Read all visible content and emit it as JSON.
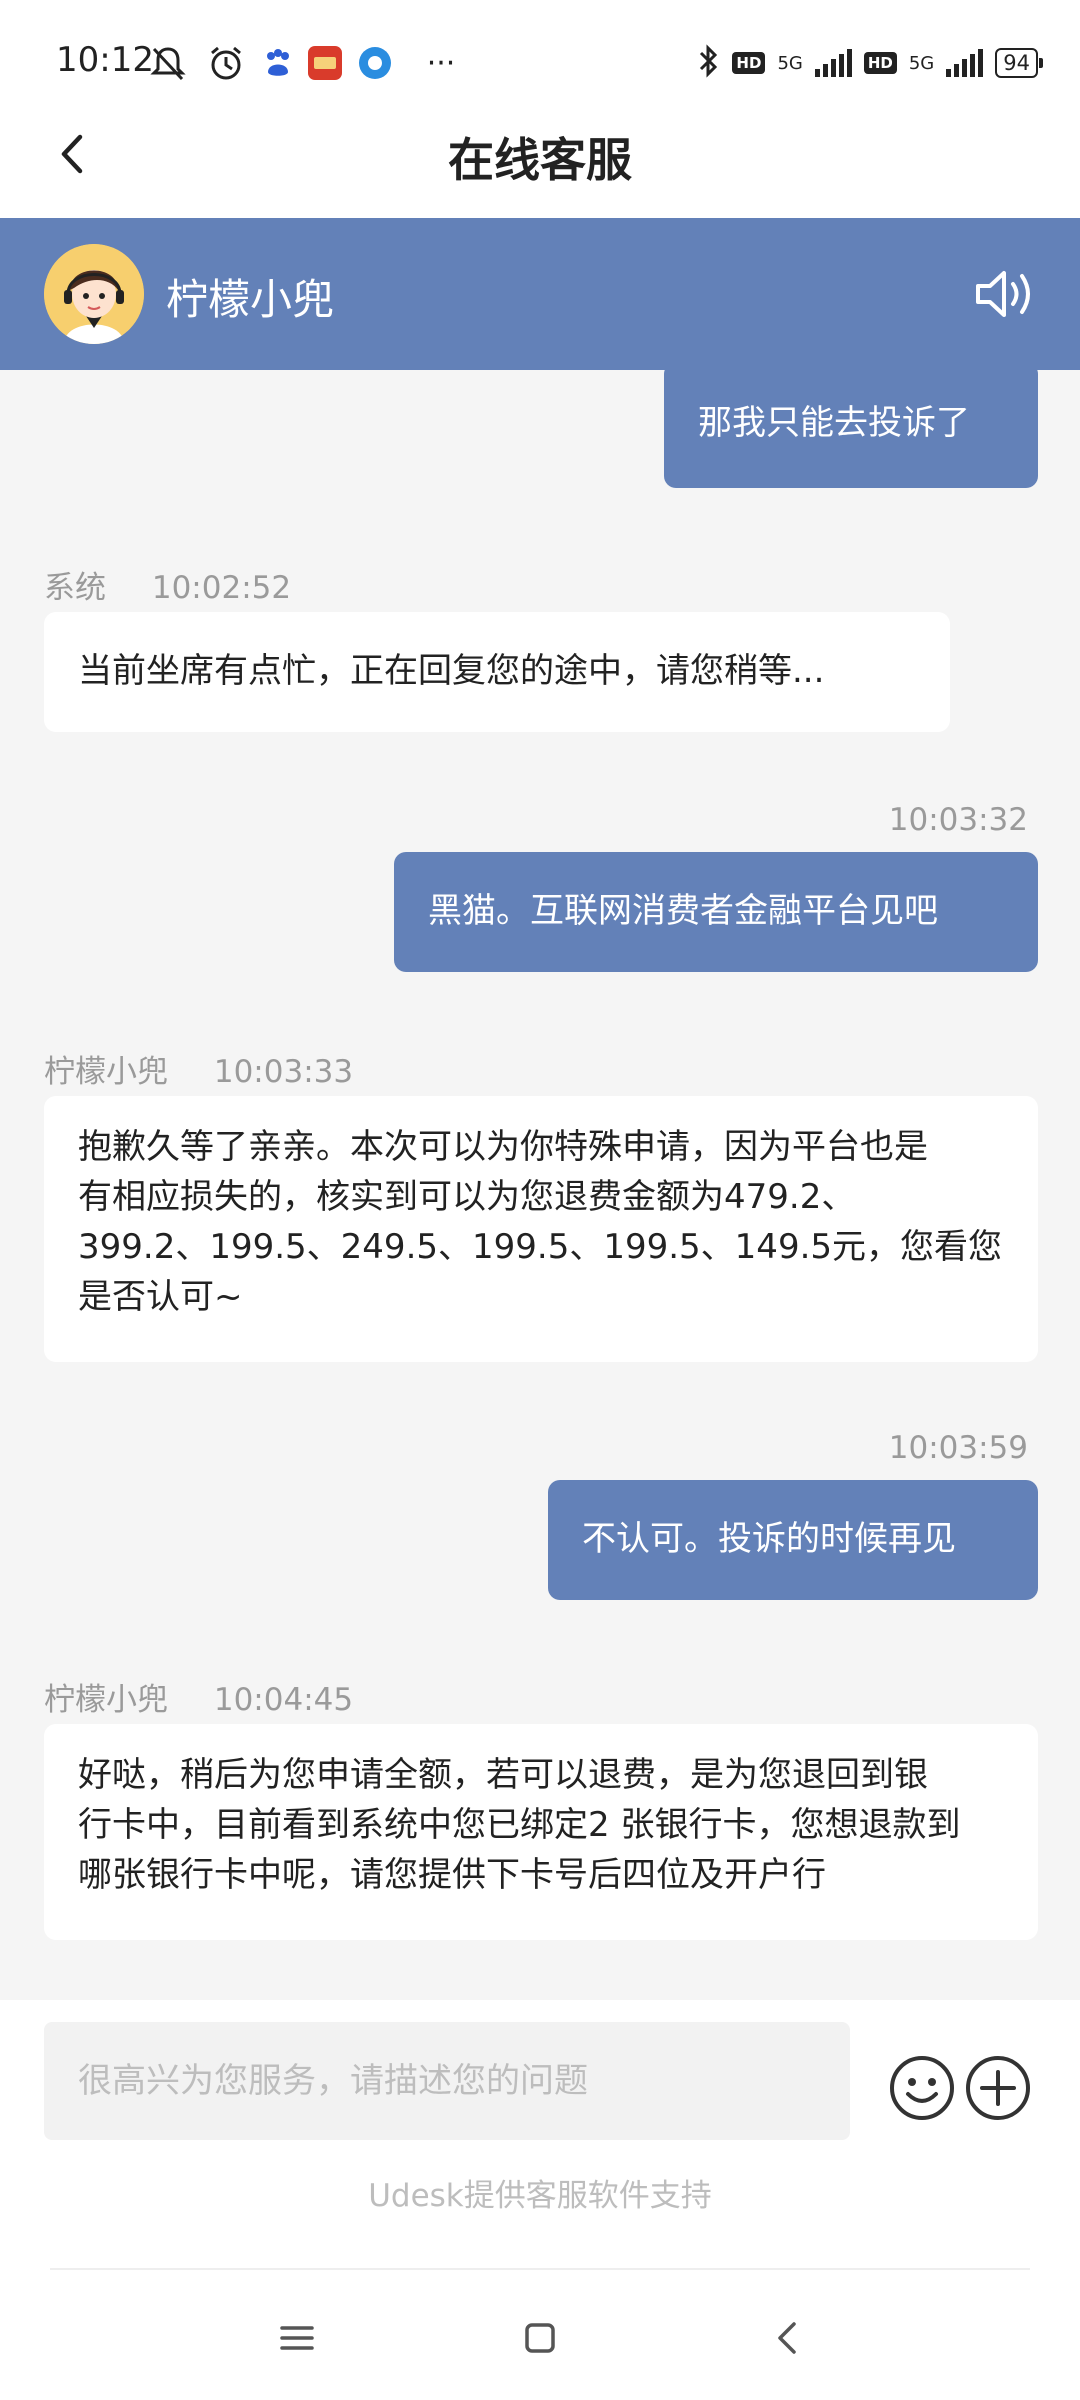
{
  "status_bar": {
    "time": "10:12",
    "icons": [
      "mute-icon",
      "alarm-icon",
      "baidu-app-icon",
      "red-app-icon",
      "blue-app-icon",
      "more-dots-icon"
    ],
    "more_dots": "···",
    "hd_label": "HD",
    "net_label": "5G",
    "battery": "94"
  },
  "titlebar": {
    "title": "在线客服"
  },
  "agent": {
    "name": "柠檬小兜"
  },
  "messages": [
    {
      "side": "out",
      "time": "",
      "text": "那我只能去投诉了"
    },
    {
      "side": "in",
      "sender": "系统",
      "time": "10:02:52",
      "text": "当前坐席有点忙，正在回复您的途中，请您稍等..."
    },
    {
      "side": "out",
      "time": "10:03:32",
      "text": "黑猫。互联网消费者金融平台见吧"
    },
    {
      "side": "in",
      "sender": "柠檬小兜",
      "time": "10:03:33",
      "lines": [
        "抱歉久等了亲亲。本次可以为你特殊申请，因为平台也是",
        "有相应损失的，核实到可以为您退费金额为479.2、",
        "399.2、199.5、249.5、199.5、199.5、149.5元，您看您",
        "是否认可~"
      ]
    },
    {
      "side": "out",
      "time": "10:03:59",
      "text": "不认可。投诉的时候再见"
    },
    {
      "side": "in",
      "sender": "柠檬小兜",
      "time": "10:04:45",
      "lines": [
        "好哒，稍后为您申请全额，若可以退费，是为您退回到银",
        "行卡中，目前看到系统中您已绑定2 张银行卡，您想退款到",
        "哪张银行卡中呢，请您提供下卡号后四位及开户行"
      ]
    }
  ],
  "input": {
    "placeholder": "很高兴为您服务，请描述您的问题",
    "support_text": "Udesk提供客服软件支持"
  },
  "colors": {
    "accent": "#6381b8",
    "background": "#f5f5f5",
    "meta_text": "#9a9a9a"
  }
}
